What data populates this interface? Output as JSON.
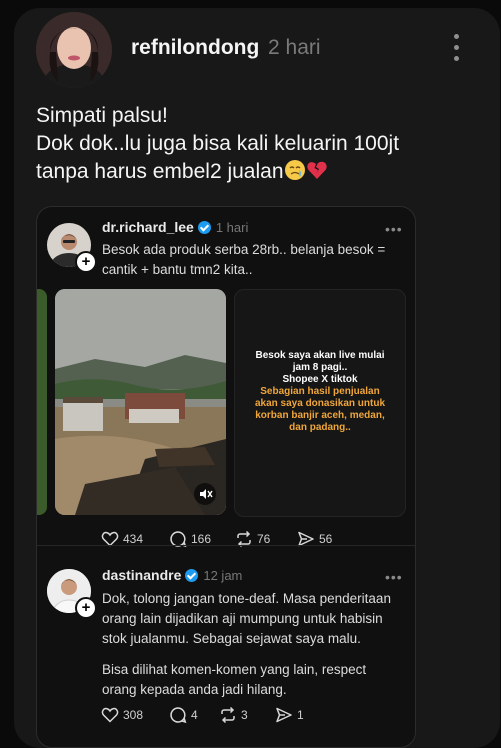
{
  "post": {
    "username": "refnilondong",
    "time": "2 hari",
    "lines": [
      "Simpati palsu!",
      "Dok dok..lu juga bisa kali keluarin 100jt",
      "tanpa harus embel2 jualan"
    ]
  },
  "quoted": {
    "username": "dr.richard_lee",
    "time": "1 hari",
    "lines": [
      "Besok ada produk serba 28rb.. belanja besok =",
      "cantik + bantu tmn2 kita.."
    ],
    "media_text": {
      "white": [
        "Besok saya akan live mulai",
        "jam 8 pagi..",
        "Shopee X tiktok"
      ],
      "orange": [
        "Sebagian hasil penjualan",
        "akan saya donasikan untuk",
        "korban banjir aceh, medan,",
        "dan padang.."
      ]
    },
    "stats": {
      "likes": "434",
      "comments": "166",
      "reposts": "76",
      "shares": "56"
    }
  },
  "reply": {
    "username": "dastinandre",
    "time": "12 jam",
    "paragraph1": [
      "Dok, tolong jangan tone-deaf. Masa penderitaan",
      "orang lain dijadikan aji mumpung untuk habisin",
      "stok jualanmu. Sebagai sejawat saya malu."
    ],
    "paragraph2": [
      "Bisa dilihat komen-komen yang lain, respect",
      "orang kepada anda jadi hilang."
    ],
    "stats": {
      "likes": "308",
      "comments": "4",
      "reposts": "3",
      "shares": "1"
    }
  },
  "colors": {
    "background": "#181818",
    "verified": "#1d9bf0",
    "orange_text": "#f0a63a",
    "emoji_heart": "#e0304a"
  },
  "icons": [
    "more-icon",
    "verified-icon",
    "heart-icon",
    "comment-icon",
    "repost-icon",
    "share-icon",
    "mute-icon",
    "crying-emoji",
    "broken-heart-emoji",
    "follow-plus-icon"
  ]
}
